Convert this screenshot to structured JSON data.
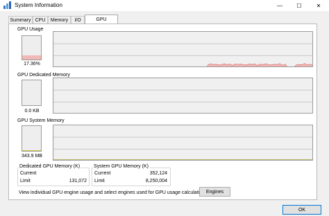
{
  "window": {
    "title": "System Information",
    "minimize": "—",
    "maximize": "☐",
    "close": "✕"
  },
  "tabs": [
    {
      "label": "Summary",
      "active": false
    },
    {
      "label": "CPU",
      "active": false
    },
    {
      "label": "Memory",
      "active": false
    },
    {
      "label": "I/O",
      "active": false
    },
    {
      "label": "GPU",
      "active": true
    }
  ],
  "gpu_usage": {
    "label": "GPU Usage",
    "value": "17.36%",
    "fraction": 0.17,
    "fill_color": "#f2b7b7",
    "line_color": "#d97a7a"
  },
  "gpu_dedicated": {
    "label": "GPU Dedicated Memory",
    "value": "0.0 KB",
    "fraction": 0.0
  },
  "gpu_system": {
    "label": "GPU System Memory",
    "value": "343.9 MB",
    "fraction": 0.04,
    "fill_color": "#c9c44a",
    "line_color": "#a39b1c"
  },
  "dedicated_group": {
    "title": "Dedicated GPU Memory (K)",
    "current_label": "Current",
    "current_value": "",
    "limit_label": "Limit",
    "limit_value": "131,072"
  },
  "system_group": {
    "title": "System GPU Memory (K)",
    "current_label": "Current",
    "current_value": "352,124",
    "limit_label": "Limit",
    "limit_value": "8,250,004"
  },
  "engines": {
    "text": "View individual GPU engine usage and select engines used for GPU usage calculations:",
    "button": "Engines"
  },
  "ok_button": "OK",
  "colors": {
    "grid": "#c8c8c8",
    "graph_bg": "#f0f0f0"
  }
}
